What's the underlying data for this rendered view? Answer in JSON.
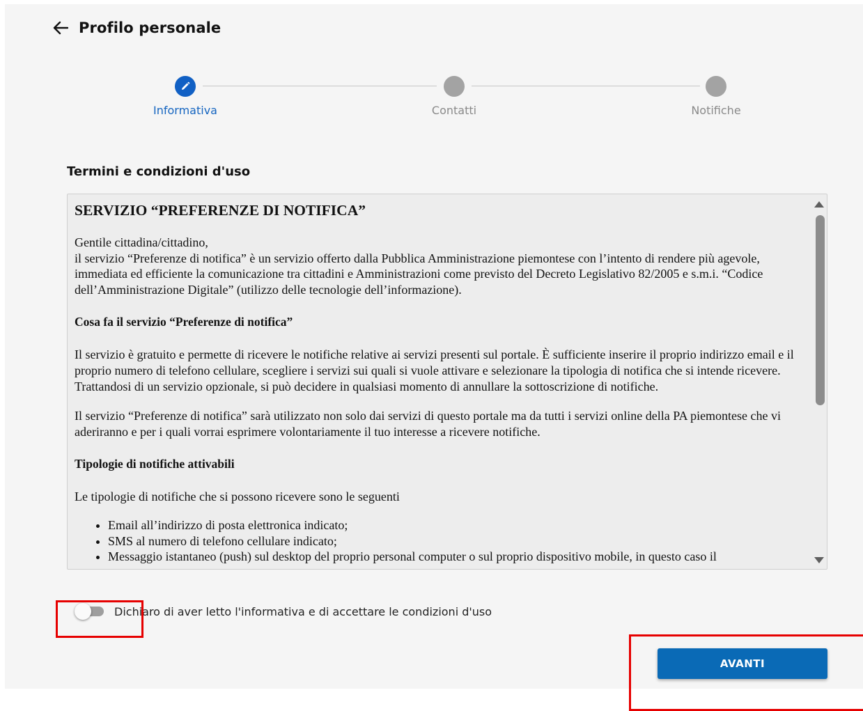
{
  "header": {
    "back_icon": "arrow-left-icon",
    "title": "Profilo personale"
  },
  "stepper": {
    "steps": [
      {
        "label": "Informativa",
        "state": "active",
        "icon": "pencil-icon"
      },
      {
        "label": "Contatti",
        "state": "inactive"
      },
      {
        "label": "Notifiche",
        "state": "inactive"
      }
    ],
    "active_color": "#1160c4",
    "inactive_color": "#a3a3a3"
  },
  "terms": {
    "section_title": "Termini e condizioni d'uso",
    "heading": "SERVIZIO “PREFERENZE DI NOTIFICA”",
    "greeting": "Gentile cittadina/cittadino,",
    "intro": "il servizio “Preferenze di notifica” è un servizio offerto dalla Pubblica Amministrazione piemontese con l’intento di rendere più agevole, immediata ed efficiente la comunicazione tra cittadini e Amministrazioni come previsto del Decreto Legislativo 82/2005 e s.m.i. “Codice dell’Amministrazione Digitale” (utilizzo delle tecnologie dell’informazione).",
    "subheading1": "Cosa fa il servizio “Preferenze di notifica”",
    "paragraph1": "Il servizio è gratuito e permette di ricevere le notifiche relative ai servizi presenti sul portale. È sufficiente inserire il proprio indirizzo email e il proprio numero di telefono cellulare, scegliere i servizi sui quali si vuole attivare e selezionare la tipologia di notifica che si intende ricevere. Trattandosi di un servizio opzionale, si può decidere in qualsiasi momento di annullare la sottoscrizione di notifiche.",
    "paragraph2": "Il servizio “Preferenze di notifica” sarà utilizzato non solo dai servizi di questo portale ma da tutti i servizi online della PA piemontese che vi aderiranno e per i quali vorrai esprimere volontariamente il tuo interesse a ricevere notifiche.",
    "subheading2": "Tipologie di notifiche attivabili",
    "paragraph3": "Le tipologie di notifiche che si possono ricevere sono le seguenti",
    "list": [
      "Email all’indirizzo di posta elettronica indicato;",
      "SMS al numero di telefono cellulare indicato;",
      "Messaggio istantaneo (push) sul desktop del proprio personal computer o sul proprio dispositivo mobile, in questo caso il"
    ]
  },
  "consent": {
    "toggle_state": "off",
    "label": "Dichiaro di aver letto l'informativa e di accettare le condizioni d'uso"
  },
  "actions": {
    "next_label": "AVANTI",
    "next_color": "#0a6ab6"
  },
  "highlight_color": "#e60000"
}
